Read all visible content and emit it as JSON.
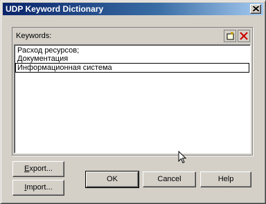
{
  "window": {
    "title": "UDP Keyword Dictionary"
  },
  "keywords_panel": {
    "label": "Keywords:",
    "items": [
      "Расход ресурсов;",
      "Документация",
      "Информационная система"
    ],
    "selected_index": 2
  },
  "buttons": {
    "export": {
      "mnemonic": "E",
      "rest": "xport..."
    },
    "import": {
      "mnemonic": "I",
      "rest": "mport..."
    },
    "ok": "OK",
    "cancel": "Cancel",
    "help": "Help"
  },
  "icons": {
    "close": "close-icon",
    "new_item": "new-item-icon",
    "delete_item": "delete-icon",
    "cursor": "mouse-pointer-icon"
  },
  "colors": {
    "titlebar_start": "#0a246a",
    "titlebar_end": "#a6caf0",
    "face": "#d4d0c8",
    "delete_red": "#cc0000"
  }
}
